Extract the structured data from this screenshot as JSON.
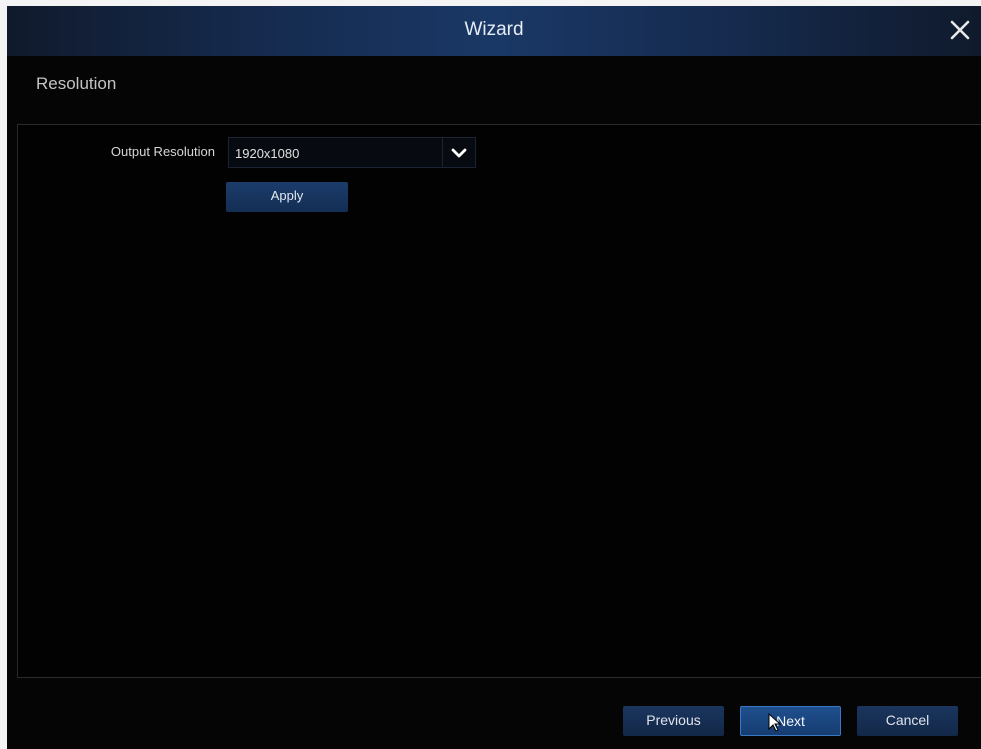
{
  "window": {
    "title": "Wizard",
    "close_icon": "close-icon"
  },
  "section": {
    "title": "Resolution"
  },
  "output_resolution": {
    "label": "Output Resolution",
    "value": "1920x1080",
    "dropdown_icon": "chevron-down-icon"
  },
  "buttons": {
    "apply": "Apply",
    "previous": "Previous",
    "next": "Next",
    "cancel": "Cancel"
  },
  "colors": {
    "background": "#050505",
    "titlebar_center": "#1a3866",
    "button": "#1a355e",
    "active_button_border": "#3a78c6"
  }
}
